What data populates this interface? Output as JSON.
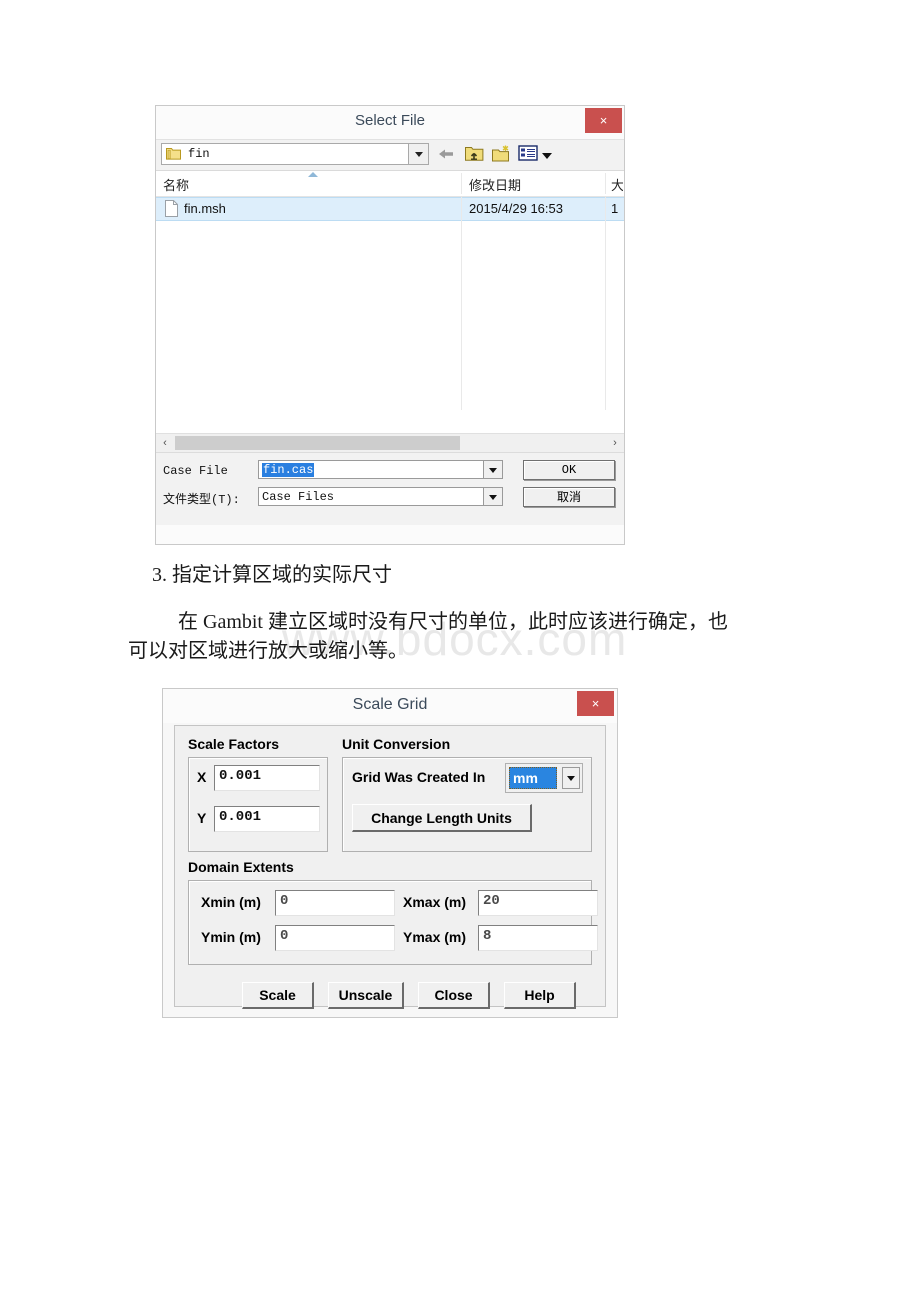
{
  "select_file_dialog": {
    "title": "Select File",
    "close_label": "×",
    "path_value": "fin",
    "toolbar": {
      "back": "back-arrow",
      "up": "up-folder",
      "new_folder": "new-folder",
      "views": "views-list"
    },
    "columns": [
      "名称",
      "修改日期",
      "大"
    ],
    "rows": [
      {
        "name": "fin.msh",
        "modified": "2015/4/29 16:53",
        "size": "1"
      }
    ],
    "case_file_label": "Case File",
    "case_file_value": "fin.cas",
    "file_type_label": "文件类型(T):",
    "file_type_value": "Case Files",
    "ok_label": "OK",
    "cancel_label": "取消",
    "scroll_left": "‹",
    "scroll_right": "›"
  },
  "document": {
    "heading": "3. 指定计算区域的实际尺寸",
    "paragraph_line1": "在 Gambit 建立区域时没有尺寸的单位，此时应该进行确定，也",
    "paragraph_line2": "可以对区域进行放大或缩小等。",
    "watermark": "www.bdocx.com"
  },
  "scale_grid_dialog": {
    "title": "Scale Grid",
    "close_label": "×",
    "scale_factors": {
      "group_label": "Scale Factors",
      "x_label": "X",
      "x_value": "0.001",
      "y_label": "Y",
      "y_value": "0.001"
    },
    "unit_conversion": {
      "group_label": "Unit Conversion",
      "created_in_label": "Grid Was Created In",
      "created_in_value": "mm",
      "change_units_label": "Change Length Units"
    },
    "domain_extents": {
      "group_label": "Domain Extents",
      "xmin_label": "Xmin (m)",
      "xmin_value": "0",
      "xmax_label": "Xmax (m)",
      "xmax_value": "20",
      "ymin_label": "Ymin (m)",
      "ymin_value": "0",
      "ymax_label": "Ymax (m)",
      "ymax_value": "8"
    },
    "buttons": {
      "scale": "Scale",
      "unscale": "Unscale",
      "close": "Close",
      "help": "Help"
    }
  },
  "colors": {
    "title_text": "#3b4a5a",
    "close_button": "#c9504e",
    "selection_blue": "#2a7fe0",
    "row_highlight": "#ddeefb",
    "watermark": "#e8e8e8"
  }
}
